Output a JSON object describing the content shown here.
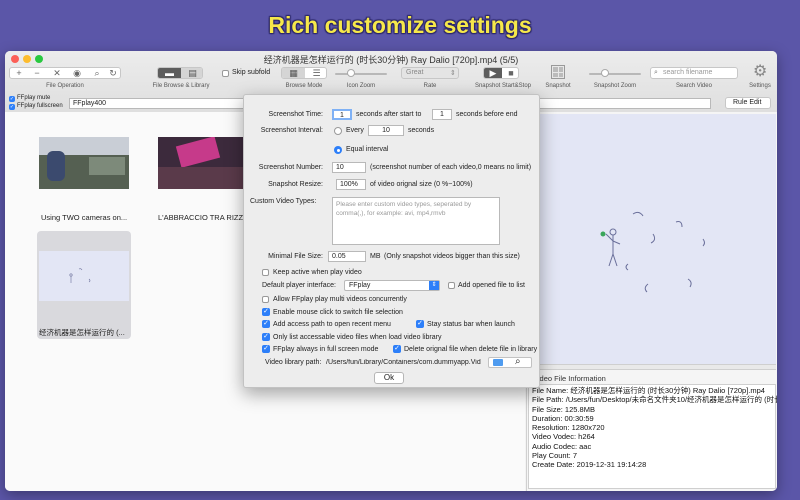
{
  "banner": {
    "title": "Rich customize settings"
  },
  "window": {
    "title": "经济机器是怎样运行的 (时长30分钟) Ray Dalio [720p].mp4 (5/5)"
  },
  "toolbar": {
    "file_operation_label": "File Operation",
    "file_browse_label": "File Browse & Library",
    "skip_subfold": "Skip subfold",
    "browse_mode_label": "Browse Mode",
    "icon_zoom_label": "Icon Zoom",
    "rate_label": "Rate",
    "rate_value": "Great",
    "snapshot_startstop_label": "Snapshot  Start&Stop",
    "snapshot_label": "Snapshot",
    "snapshot_zoom_label": "Snapshot Zoom",
    "search_placeholder": "search filename",
    "search_video_label": "Search Video",
    "settings_label": "Settings"
  },
  "subbar": {
    "ffplay_mute": "FFplay mute",
    "ffplay_fullscreen": "FFplay fullscreen",
    "player_field": "FFplay400",
    "rule_edit": "Rule Edit"
  },
  "thumbnails": [
    {
      "label": "Using TWO cameras on..."
    },
    {
      "label": "L'ABBRACCIO TRA RIZZ..."
    },
    {
      "label": "经济机器是怎样运行的 (..."
    }
  ],
  "dialog": {
    "screenshot_time_label": "Screenshot Time:",
    "screenshot_time_start": "1",
    "after_start_text": "seconds after start to",
    "screenshot_time_end": "1",
    "before_end_text": "seconds before end",
    "screenshot_interval_label": "Screenshot Interval:",
    "every_label": "Every",
    "every_value": "10",
    "seconds_text": "seconds",
    "equal_interval": "Equal interval",
    "screenshot_number_label": "Screenshot Number:",
    "screenshot_number_value": "10",
    "screenshot_number_hint": "(screenshot number of each video,0 means no limit)",
    "snapshot_resize_label": "Snapshot Resize:",
    "snapshot_resize_value": "100%",
    "snapshot_resize_hint": "of video orignal size (0 %~100%)",
    "custom_types_label": "Custom Video Types:",
    "custom_types_placeholder": "Please enter custom video types, seperated by comma(,), for example: avi, mp4,rmvb",
    "minimal_size_label": "Minimal File Size:",
    "minimal_size_value": "0.05",
    "minimal_size_unit": "MB",
    "minimal_size_hint": "(Only snapshot videos bigger than this size)",
    "keep_active": "Keep active when play video",
    "default_player_label": "Default player interface:",
    "default_player_value": "FFplay",
    "add_opened_file": "Add opened file to list",
    "allow_multi": "Allow FFplay play multi videos concurrently",
    "enable_mouse": "Enable mouse click to switch file selection",
    "add_access_path": "Add access path to open recent menu",
    "stay_status_bar": "Stay status bar when launch",
    "only_list": "Only list accessable video files when load video library",
    "ffplay_fullscreen": "FFplay always in full screen mode",
    "delete_original": "Delete orignal file when delete file in library",
    "video_library_label": "Video library path:",
    "video_library_value": "/Users/fun/Library/Containers/com.dummyapp.Vid",
    "ok": "Ok"
  },
  "info": {
    "header": "Video File  Information",
    "lines": [
      "File Name: 经济机器是怎样运行的 (时长30分钟) Ray Dalio [720p].mp4",
      "File Path: /Users/fun/Desktop/未命名文件夹10/经济机器是怎样运行的 (时长3",
      "File Size: 125.8MB",
      "Duration: 00:30:59",
      "Resolution: 1280x720",
      "Video Vodec: h264",
      "Audio Codec: aac",
      "Play Count: 7",
      "Create Date: 2019-12-31 19:14:28"
    ]
  },
  "colors": {
    "background": "#5b56a8",
    "banner_text": "#f6e84a",
    "accent": "#2d7ff9"
  }
}
